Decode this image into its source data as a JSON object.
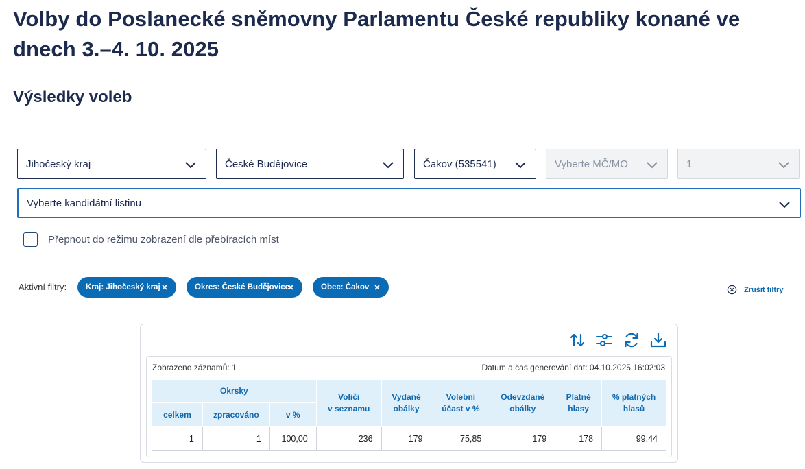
{
  "page": {
    "title": "Volby do Poslanecké sněmovny Parlamentu České republiky konané ve dnech 3.–4. 10. 2025",
    "section_title": "Výsledky voleb"
  },
  "filters": {
    "kraj": "Jihočeský kraj",
    "okres": "České Budějovice",
    "obec": "Čakov (535541)",
    "mcmo_placeholder": "Vyberte MČ/MO",
    "okrsek": "1",
    "kandidatni_listina_placeholder": "Vyberte kandidátní listinu",
    "checkbox_label": "Přepnout do režimu zobrazení dle přebíracích míst"
  },
  "active_filters": {
    "label": "Aktivní filtry:",
    "chips": [
      "Kraj: Jihočeský kraj",
      "Okres: České Budějovice",
      "Obec: Čakov"
    ],
    "clear_label": "Zrušit filtry"
  },
  "toolbar": {
    "icons": [
      "sort-icon",
      "filter-settings-icon",
      "refresh-icon",
      "download-icon"
    ]
  },
  "table": {
    "records_shown": "Zobrazeno záznamů: 1",
    "generated_at": "Datum a čas generování dat: 04.10.2025 16:02:03",
    "header_group": "Okrsky",
    "sub_headers": [
      "celkem",
      "zpracováno",
      "v %"
    ],
    "headers": {
      "volici_l1": "Voliči",
      "volici_l2": "v seznamu",
      "vydane_l1": "Vydané",
      "vydane_l2": "obálky",
      "ucast_l1": "Volební",
      "ucast_l2": "účast v %",
      "odevzdane_l1": "Odevzdané",
      "odevzdane_l2": "obálky",
      "platne_l1": "Platné",
      "platne_l2": "hlasy",
      "pct_l1": "% platných",
      "pct_l2": "hlasů"
    },
    "row": [
      "1",
      "1",
      "100,00",
      "236",
      "179",
      "75,85",
      "179",
      "178",
      "99,44"
    ]
  },
  "colors": {
    "accent": "#0b6cb5",
    "header_bg": "#dff0fb",
    "title_text": "#1c2a4e"
  }
}
